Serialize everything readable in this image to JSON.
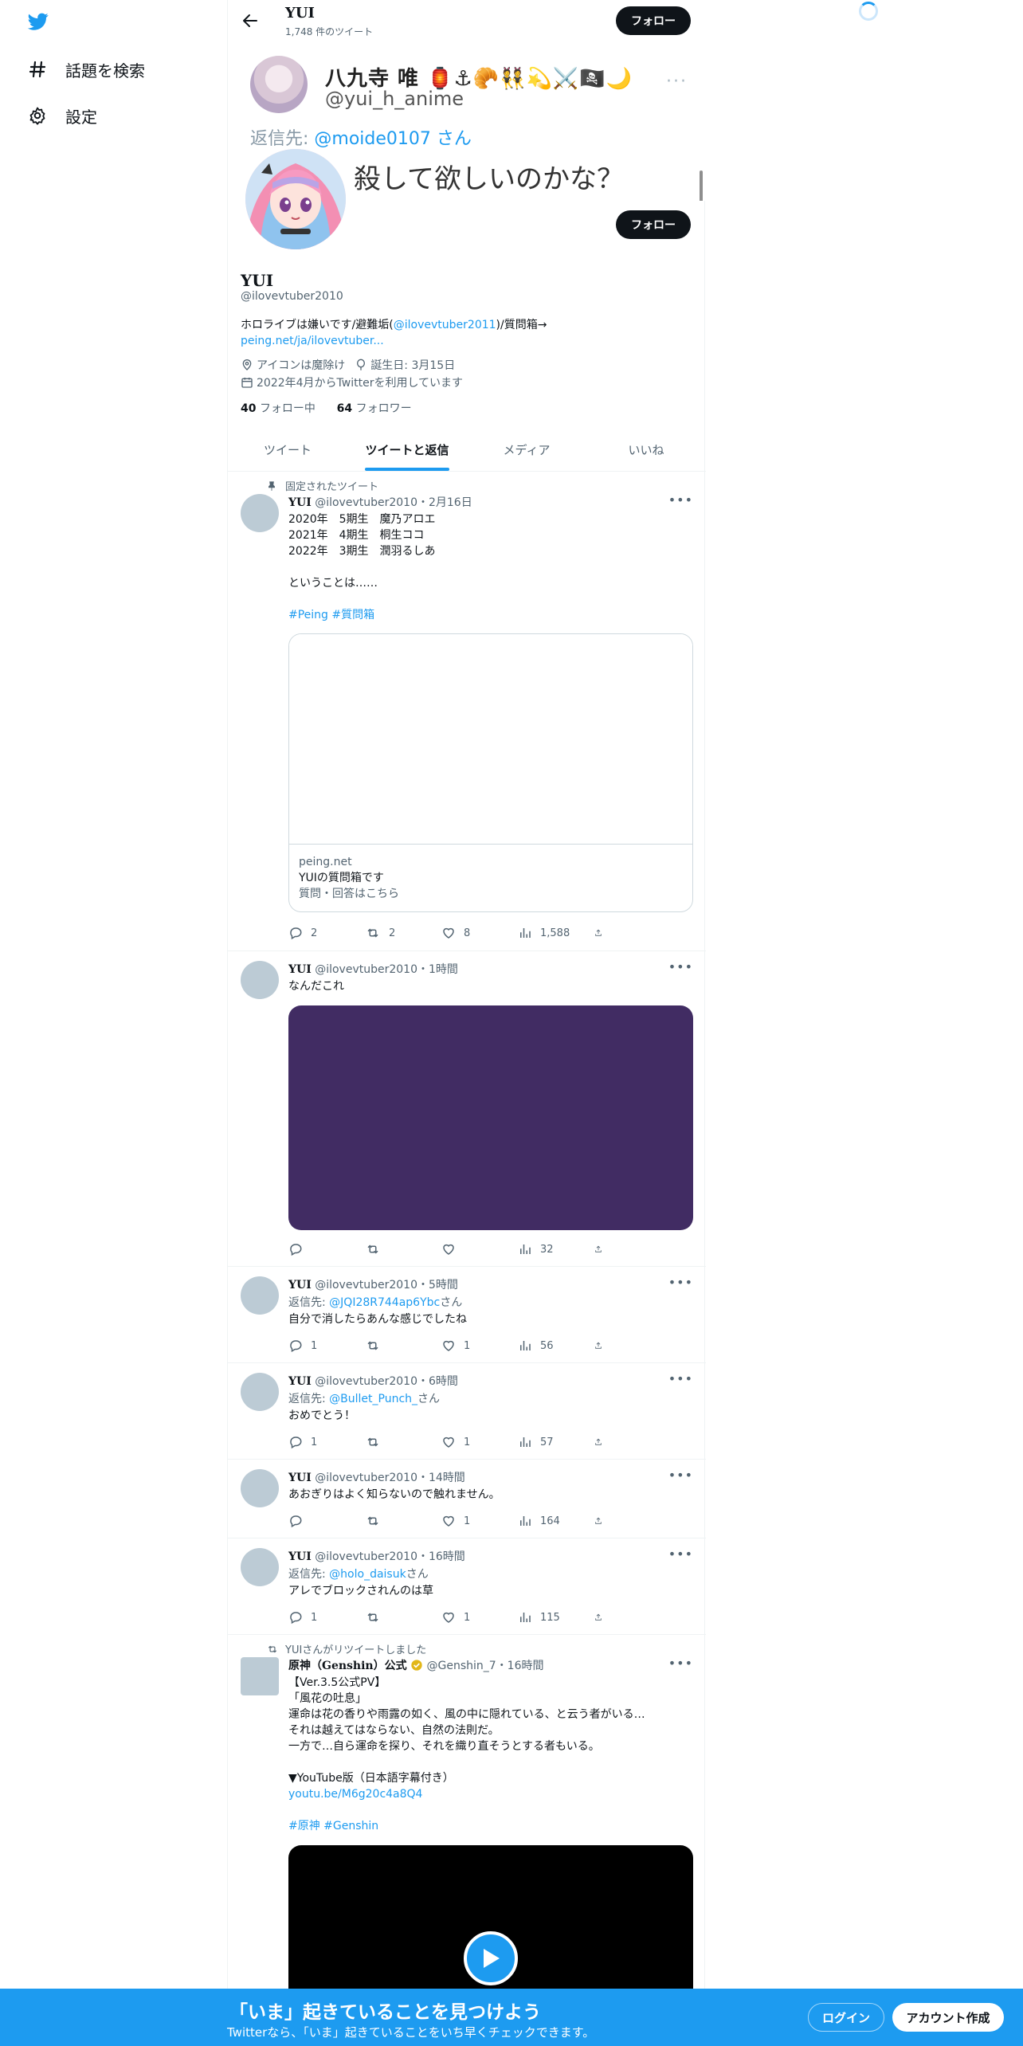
{
  "nav": {
    "explore_label": "話題を検索",
    "settings_label": "設定"
  },
  "header": {
    "name": "YUI",
    "tweet_count": "1,748 件のツイート",
    "follow_label": "フォロー"
  },
  "banner": {
    "name": "八九寺 唯 🏮⚓🥐👯💫⚔️🏴‍☠️🌙",
    "handle": "@yui_h_anime",
    "more": "···",
    "reply_prefix": "返信先: ",
    "reply_account": "@moide0107",
    "reply_suffix": " さん",
    "text": "殺して欲しいのかな？"
  },
  "profile": {
    "name": "YUI",
    "handle": "@ilovevtuber2010",
    "bio_1": "ホロライブは嫌いです/避難垢(",
    "bio_link": "@ilovevtuber2011",
    "bio_2": ")/質問箱→",
    "bio_url": "peing.net/ja/ilovevtuber...",
    "location": "アイコンは魔除け",
    "birthday": "誕生日: 3月15日",
    "joined": "2022年4月からTwitterを利用しています",
    "following_count": "40",
    "following_label": "フォロー中",
    "followers_count": "64",
    "followers_label": "フォロワー"
  },
  "tabs": [
    {
      "label": "ツイート"
    },
    {
      "label": "ツイートと返信"
    },
    {
      "label": "メディア"
    },
    {
      "label": "いいね"
    }
  ],
  "tweets": [
    {
      "pinned_label": "固定されたツイート",
      "name": "YUI",
      "meta": " @ilovevtuber2010・2月16日",
      "body": "2020年　5期生　魔乃アロエ\n2021年　4期生　桐生ココ\n2022年　3期生　潤羽るしあ\n\nということは……",
      "hashtags": "#Peing #質問箱",
      "card_domain": "peing.net",
      "card_title": "YUIの質問箱です",
      "card_desc": "質問・回答はこちら",
      "replies": "2",
      "retweets": "2",
      "likes": "8",
      "views": "1,588"
    },
    {
      "name": "YUI",
      "meta": " @ilovevtuber2010・1時間",
      "body": "なんだこれ",
      "replies": "",
      "retweets": "",
      "likes": "",
      "views": "32"
    },
    {
      "name": "YUI",
      "meta": " @ilovevtuber2010・5時間",
      "reply_prefix": "返信先: ",
      "reply_to": "@JQI28R744ap6Ybc",
      "reply_suffix": "さん",
      "body": "自分で消したらあんな感じでしたね",
      "replies": "1",
      "retweets": "",
      "likes": "1",
      "views": "56"
    },
    {
      "name": "YUI",
      "meta": " @ilovevtuber2010・6時間",
      "reply_prefix": "返信先: ",
      "reply_to": "@Bullet_Punch_",
      "reply_suffix": "さん",
      "body": "おめでとう！",
      "replies": "1",
      "retweets": "",
      "likes": "1",
      "views": "57"
    },
    {
      "name": "YUI",
      "meta": " @ilovevtuber2010・14時間",
      "body": "あおぎりはよく知らないので触れません。",
      "replies": "",
      "retweets": "",
      "likes": "1",
      "views": "164"
    },
    {
      "name": "YUI",
      "meta": " @ilovevtuber2010・16時間",
      "reply_prefix": "返信先: ",
      "reply_to": "@holo_daisuk",
      "reply_suffix": "さん",
      "body": "アレでブロックされんのは草",
      "replies": "1",
      "retweets": "",
      "likes": "1",
      "views": "115"
    },
    {
      "retweet_label": "YUIさんがリツイートしました",
      "name": "原神（Genshin）公式",
      "meta": " @Genshin_7・16時間",
      "body": "【Ver.3.5公式PV】\n「風花の吐息」\n運命は花の香りや雨露の如く、風の中に隠れている、と云う者がいる…\nそれは越えてはならない、自然の法則だ。\n一方で…自ら運命を探り、それを織り直そうとする者もいる。\n\n▼YouTube版（日本語字幕付き）",
      "link": "youtu.be/M6g20c4a8Q4",
      "hashtags": "#原神 #Genshin"
    }
  ],
  "bottom_bar": {
    "title": "「いま」起きていることを見つけよう",
    "subtitle": "Twitterなら、「いま」起きていることをいち早くチェックできます。",
    "login_label": "ログイン",
    "signup_label": "アカウント作成"
  },
  "colors": {
    "accent": "#1d9bf0",
    "text": "#0f1419",
    "muted": "#536471",
    "media_purple": "#412c63"
  }
}
